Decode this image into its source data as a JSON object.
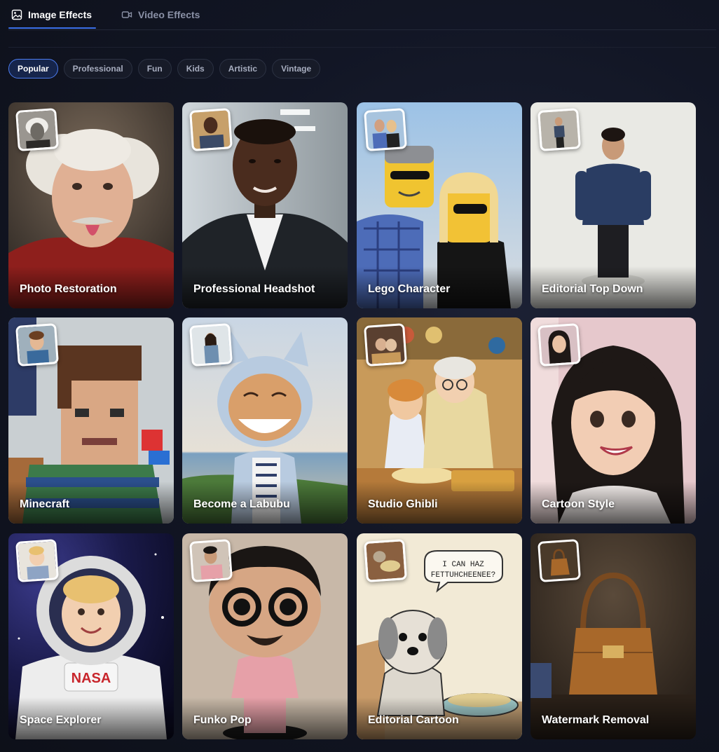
{
  "tabs": [
    {
      "label": "Image Effects",
      "icon": "image-icon",
      "active": true
    },
    {
      "label": "Video Effects",
      "icon": "video-icon",
      "active": false
    }
  ],
  "filters": [
    "Popular",
    "Professional",
    "Fun",
    "Kids",
    "Artistic",
    "Vintage"
  ],
  "active_filter": "Popular",
  "cards": [
    {
      "title": "Photo Restoration"
    },
    {
      "title": "Professional Headshot"
    },
    {
      "title": "Lego Character"
    },
    {
      "title": "Editorial Top Down"
    },
    {
      "title": "Minecraft"
    },
    {
      "title": "Become a Labubu"
    },
    {
      "title": "Studio Ghibli"
    },
    {
      "title": "Cartoon Style"
    },
    {
      "title": "Space Explorer"
    },
    {
      "title": "Funko Pop"
    },
    {
      "title": "Editorial Cartoon",
      "speech": "I CAN HAZ FETTUHCHEENEE?"
    },
    {
      "title": "Watermark Removal"
    }
  ],
  "colors": {
    "accent": "#3b6fe8",
    "background": "#121625"
  }
}
